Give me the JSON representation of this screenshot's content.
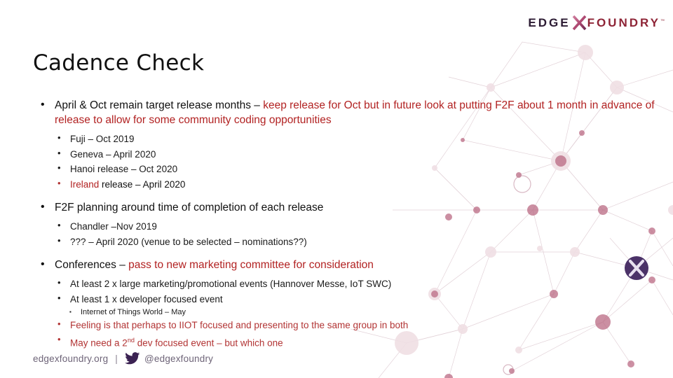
{
  "logo": {
    "part1": "EDGE",
    "x_mark": "x-logo-icon",
    "part2": "FOUNDRY",
    "trademark": "™",
    "color_edge": "#2c1b33",
    "color_foundry": "#8e2436"
  },
  "title": "Cadence Check",
  "colors": {
    "red_accent": "#b22222",
    "body_black": "#111111",
    "footer_grey": "#6e6478",
    "badge_purple": "#4b3268"
  },
  "content": {
    "bullet1": {
      "black_part": "April & Oct remain target release months – ",
      "red_part": "keep release for Oct but in future look at putting F2F about 1 month in advance of release to allow for some community coding opportunities"
    },
    "releases": [
      {
        "red_part": "",
        "black_part": "Fuji – Oct 2019"
      },
      {
        "red_part": "",
        "black_part": "Geneva – April 2020"
      },
      {
        "red_part": "",
        "black_part": "Hanoi release – Oct 2020"
      },
      {
        "red_part": "Ireland",
        "black_part": " release – April 2020"
      }
    ],
    "bullet2": "F2F planning around time of completion of each release",
    "f2f_items": [
      "Chandler –Nov 2019",
      "??? – April 2020 (venue to be selected – nominations??)"
    ],
    "bullet3": {
      "black_part": "Conferences – ",
      "red_part": "pass to new marketing committee for consideration"
    },
    "conference_items": [
      "At least 2 x large marketing/promotional events (Hannover Messe, IoT SWC)",
      "At least 1 x developer focused event"
    ],
    "sub_sub_item": "Internet of Things World – May",
    "red_items": [
      "Feeling is that perhaps to IIOT focused and presenting to the same group in both"
    ],
    "red_item_2": {
      "before": "May need a 2",
      "superscript": "nd",
      "after": " dev focused event – but which one"
    }
  },
  "footer": {
    "website": "edgexfoundry.org",
    "separator": "|",
    "twitter_icon": "twitter-bird-icon",
    "handle": "@edgexfoundry"
  }
}
